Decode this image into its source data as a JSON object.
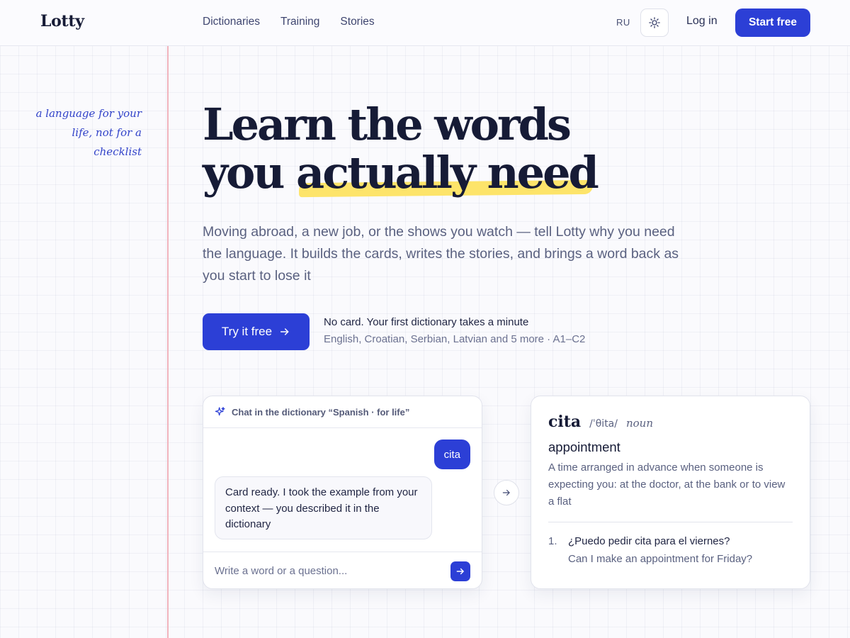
{
  "brand": {
    "logo": "Lotty",
    "accent": "#2c3fd6",
    "highlight": "#fde46a",
    "margin_line": "#f1b4bd"
  },
  "nav": {
    "items": [
      "Dictionaries",
      "Training",
      "Stories"
    ]
  },
  "header": {
    "lang": "RU",
    "theme_icon": "sun-icon",
    "login": "Log in",
    "start": "Start free"
  },
  "side_note": {
    "lines": [
      "a language for your",
      "life, not for a",
      "checklist"
    ]
  },
  "hero": {
    "title_line1": "Learn the words",
    "title_line2_plain": "you ",
    "title_line2_highlight": "actually need",
    "subtitle": "Moving abroad, a new job, or the shows you watch — tell Lotty why you need the language. It builds the cards, writes the stories, and brings a word back as you start to lose it",
    "cta": "Try it free",
    "cta_icon": "arrow-right-icon",
    "note_primary": "No card. Your first dictionary takes a minute",
    "note_secondary": "English, Croatian, Serbian, Latvian and 5 more · A1–C2"
  },
  "chat": {
    "header_icon": "sparkle-icon",
    "header": "Chat in the dictionary “Spanish · for life”",
    "user_message": "cita",
    "bot_message": "Card ready. I took the example from your context — you described it in the dictionary",
    "input_placeholder": "Write a word or a question...",
    "send_icon": "arrow-right-icon"
  },
  "connector_icon": "arrow-right-icon",
  "card": {
    "word": "cita",
    "ipa": "/ˈθita/",
    "pos": "noun",
    "translation": "appointment",
    "definition": "A time arranged in advance when someone is expecting you: at the doctor, at the bank or to view a flat",
    "examples": [
      {
        "num": "1.",
        "source": "¿Puedo pedir cita para el viernes?",
        "translation": "Can I make an appointment for Friday?"
      }
    ]
  }
}
